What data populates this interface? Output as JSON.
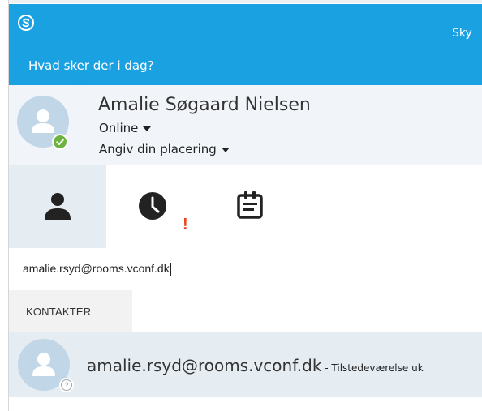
{
  "window": {
    "app_title": "Sky"
  },
  "header": {
    "mood_placeholder": "Hvad sker der i dag?",
    "colors": {
      "accent": "#19a1e2"
    }
  },
  "profile": {
    "name": "Amalie Søgaard Nielsen",
    "status": "Online",
    "location": "Angiv din placering",
    "presence": "online"
  },
  "tabs": [
    {
      "name": "contacts",
      "icon": "person-icon",
      "selected": true
    },
    {
      "name": "recent",
      "icon": "clock-icon",
      "alert": "!"
    },
    {
      "name": "meetings",
      "icon": "calendar-notes-icon"
    }
  ],
  "search": {
    "value": "amalie.rsyd@rooms.vconf.dk"
  },
  "contacts": {
    "group_label": "KONTAKTER",
    "items": [
      {
        "name": "amalie.rsyd@rooms.vconf.dk",
        "status": " - Tilstedeværelse uk",
        "presence": "unknown",
        "presence_glyph": "?"
      }
    ]
  }
}
